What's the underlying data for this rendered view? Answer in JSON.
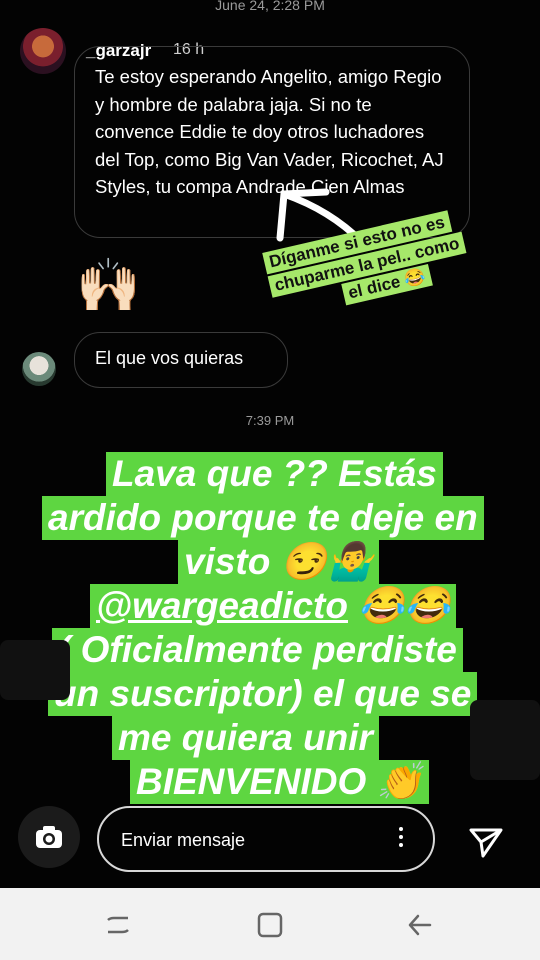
{
  "status_timestamp": "June 24, 2:28 PM",
  "header": {
    "username": "_garzajr",
    "time_ago": "16 h"
  },
  "messages": {
    "incoming_text": "Te estoy esperando Angelito, amigo Regio y hombre de palabra jaja. Si no te convence Eddie te doy otros luchadores del Top, como Big Van Vader, Ricochet, AJ Styles, tu compa Andrade Cien Almas",
    "hands_emoji": "🙌🏻",
    "reply_text": "El que vos quieras",
    "time_divider": "7:39 PM"
  },
  "sticker": {
    "lines": [
      "Díganme si esto no es",
      "chuparme la pel.. como",
      "el dice 😂"
    ]
  },
  "overlay": {
    "line1": "Lava que ?? Estás",
    "line2": "ardido porque te deje en",
    "line3": "visto 😏🤷‍♂️",
    "mention": "@wargeadicto",
    "mention_emoji": " 😂😂",
    "line5": "( Oficialmente perdiste",
    "line6": "un suscriptor) el que se",
    "line7": "me quiera unir",
    "line8": "BIENVENIDO 👏"
  },
  "bottom": {
    "placeholder": "Enviar mensaje"
  },
  "colors": {
    "overlay_green": "#5ed641",
    "sticker_green": "#a6e86a"
  },
  "icons": {
    "camera": "camera-icon",
    "send": "send-icon",
    "more": "more-vertical-icon"
  }
}
